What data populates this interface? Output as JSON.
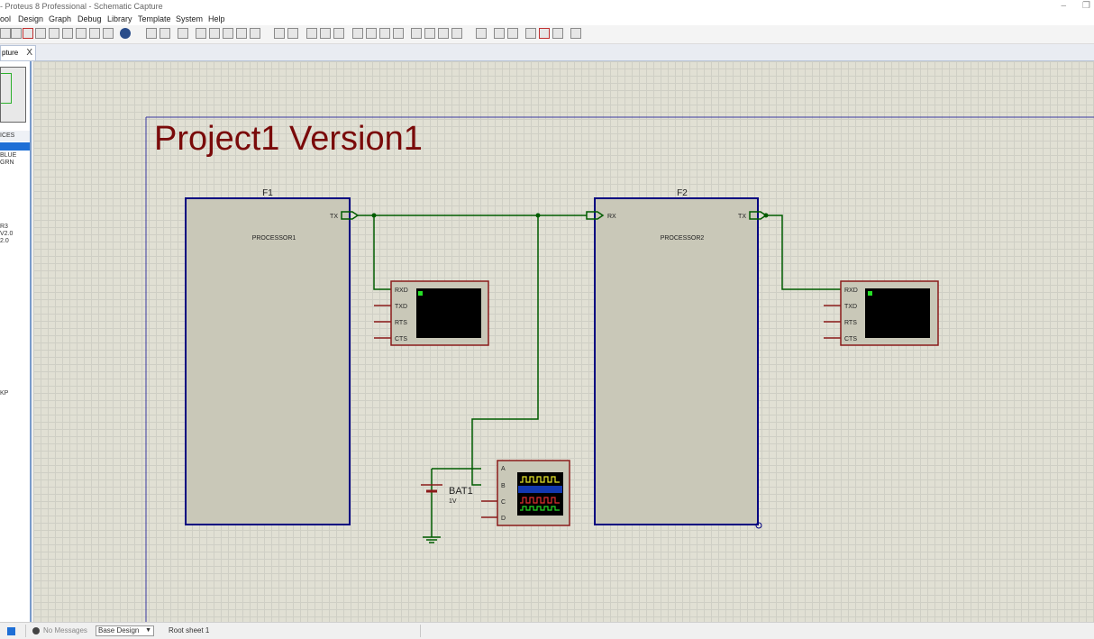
{
  "window": {
    "title": "- Proteus 8 Professional - Schematic Capture",
    "minimize": "–",
    "restore": "❐"
  },
  "menu": [
    "ool",
    "Design",
    "Graph",
    "Debug",
    "Library",
    "Template",
    "System",
    "Help"
  ],
  "tab": {
    "label": "pture",
    "close": "X"
  },
  "left_panel": {
    "header": "ICES",
    "items": [
      "BLUE",
      "GRN",
      "R3",
      "V2.0",
      "2.0",
      "KP"
    ]
  },
  "schematic": {
    "title": "Project1 Version1",
    "processors": [
      {
        "ref": "F1",
        "name": "PROCESSOR1",
        "pins": [
          "TX"
        ]
      },
      {
        "ref": "F2",
        "name": "PROCESSOR2",
        "pins": [
          "RX",
          "TX"
        ]
      }
    ],
    "terminal_pins": [
      "RXD",
      "TXD",
      "RTS",
      "CTS"
    ],
    "battery": {
      "ref": "BAT1",
      "value": "1V"
    },
    "scope_pins": [
      "A",
      "B",
      "C",
      "D"
    ],
    "colors": {
      "wire": "#005c00",
      "component_border": "#000080",
      "instrument_border": "#8b1a1a",
      "title_text": "#7a0a0a",
      "grid_bg": "#e1e0d4",
      "component_fill": "#c9c8b8"
    }
  },
  "status": {
    "messages": "No Messages",
    "design": "Base Design",
    "sheet": "Root sheet 1"
  }
}
